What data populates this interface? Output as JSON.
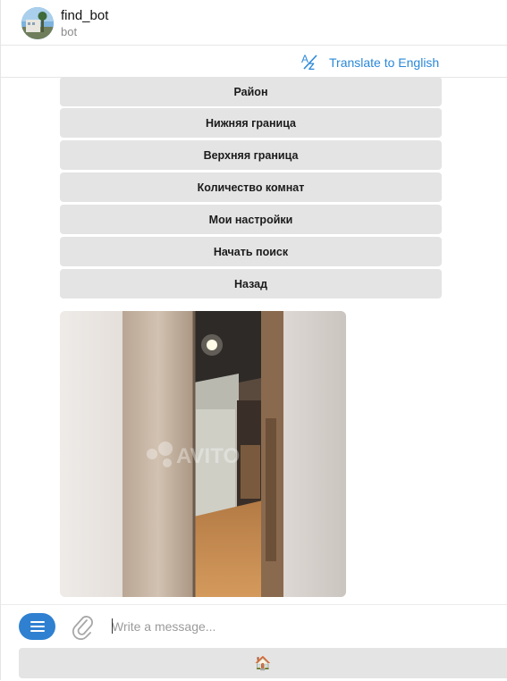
{
  "chat": {
    "title": "find_bot",
    "subtitle": "bot",
    "avatar_icon": "avatar-photo"
  },
  "translate": {
    "label": "Translate to English",
    "icon": "translate-icon",
    "color": "#2b88d8"
  },
  "keyboard": {
    "buttons": [
      {
        "label": "Район"
      },
      {
        "label": "Нижняя граница"
      },
      {
        "label": "Верхняя граница"
      },
      {
        "label": "Количество комнат"
      },
      {
        "label": "Мои настройки"
      },
      {
        "label": "Начать поиск"
      },
      {
        "label": "Назад"
      }
    ]
  },
  "message": {
    "photo": {
      "description_icon": "apartment-hallway-photo",
      "watermark": "AVITO"
    }
  },
  "composer": {
    "menu_icon": "menu-icon",
    "attach_icon": "paperclip-icon",
    "placeholder": "Write a message...",
    "accent": "#2f80d1",
    "bottom_button": {
      "label": "🏠",
      "icon": "house-icon"
    }
  }
}
